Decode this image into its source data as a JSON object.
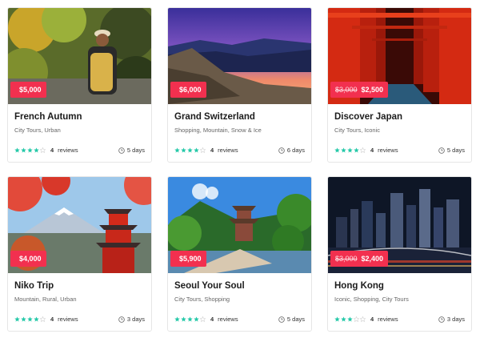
{
  "colors": {
    "price_badge": "#f2304f",
    "star": "#27c9a9",
    "star_empty": "#cfcfcf"
  },
  "tours": [
    {
      "title": "French Autumn",
      "tags": "City Tours, Urban",
      "price": "$5,000",
      "old_price": "",
      "rating": 4,
      "reviews_count": "4",
      "reviews_label": "reviews",
      "duration": "5 days",
      "image": "hiker-autumn-forest"
    },
    {
      "title": "Grand Switzerland",
      "tags": "Shopping, Mountain, Snow & Ice",
      "price": "$6,000",
      "old_price": "",
      "rating": 4,
      "reviews_count": "4",
      "reviews_label": "reviews",
      "duration": "6 days",
      "image": "mountain-sunset"
    },
    {
      "title": "Discover Japan",
      "tags": "City Tours, Iconic",
      "price": "$2,500",
      "old_price": "$3,000",
      "rating": 4,
      "reviews_count": "4",
      "reviews_label": "reviews",
      "duration": "5 days",
      "image": "torii-gates-tunnel"
    },
    {
      "title": "Niko Trip",
      "tags": "Mountain, Rural, Urban",
      "price": "$4,000",
      "old_price": "",
      "rating": 4,
      "reviews_count": "4",
      "reviews_label": "reviews",
      "duration": "3 days",
      "image": "pagoda-fuji"
    },
    {
      "title": "Seoul Your Soul",
      "tags": "City Tours, Shopping",
      "price": "$5,900",
      "old_price": "",
      "rating": 4,
      "reviews_count": "4",
      "reviews_label": "reviews",
      "duration": "5 days",
      "image": "korean-pavilion"
    },
    {
      "title": "Hong Kong",
      "tags": "Iconic, Shopping, City Tours",
      "price": "$2,400",
      "old_price": "$3,000",
      "rating": 3,
      "reviews_count": "4",
      "reviews_label": "reviews",
      "duration": "3 days",
      "image": "city-night-skyline"
    }
  ]
}
